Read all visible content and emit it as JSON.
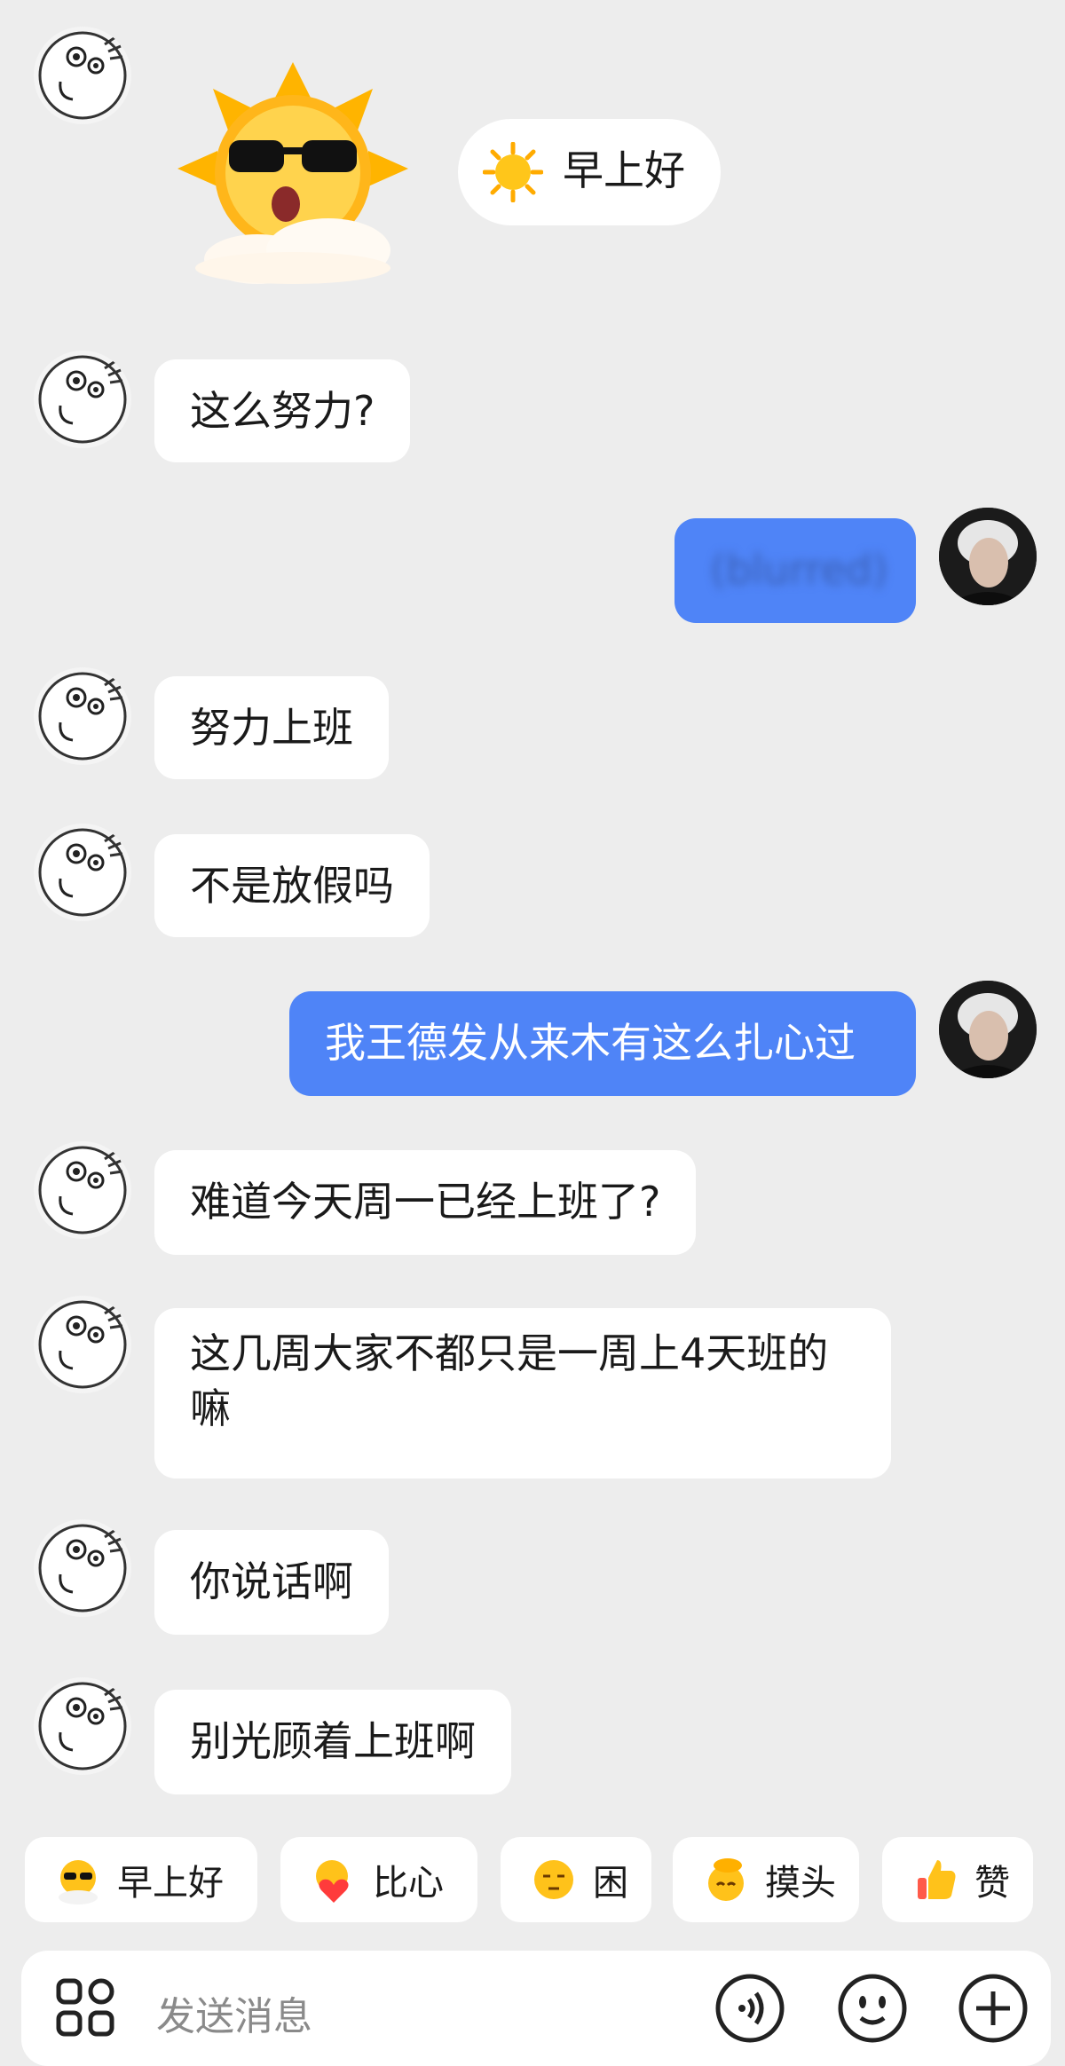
{
  "messages": [
    {
      "side": "other",
      "type": "sticker_and_text",
      "text": "早上好",
      "emoji": "sun-icon"
    },
    {
      "side": "other",
      "text": "这么努力?"
    },
    {
      "side": "self",
      "text": "(blurred)"
    },
    {
      "side": "other",
      "text": "努力上班"
    },
    {
      "side": "other",
      "text": "不是放假吗"
    },
    {
      "side": "self",
      "text": "我王德发从来木有这么扎心过"
    },
    {
      "side": "other",
      "text": "难道今天周一已经上班了?"
    },
    {
      "side": "other",
      "text": "这几周大家不都只是一周上4天班的嘛"
    },
    {
      "side": "other",
      "text": "你说话啊"
    },
    {
      "side": "other",
      "text": "别光顾着上班啊"
    }
  ],
  "quick_replies": [
    {
      "label": "早上好",
      "icon": "sunglasses-sun-icon"
    },
    {
      "label": "比心",
      "icon": "heart-hands-icon"
    },
    {
      "label": "困",
      "icon": "sleepy-face-icon"
    },
    {
      "label": "摸头",
      "icon": "pat-head-icon"
    },
    {
      "label": "赞",
      "icon": "thumbs-up-icon"
    }
  ],
  "input": {
    "placeholder": "发送消息"
  },
  "colors": {
    "background": "#ededed",
    "self_bubble": "#4f84f7",
    "other_bubble": "#ffffff"
  }
}
